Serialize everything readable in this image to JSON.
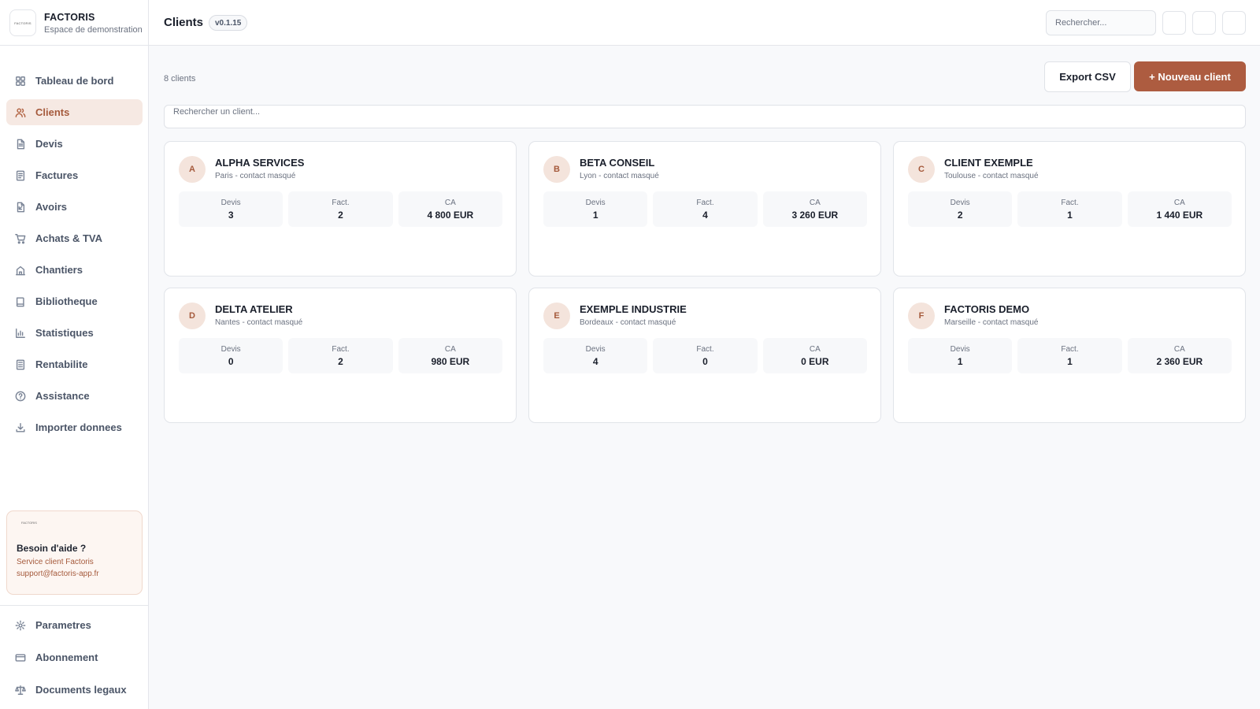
{
  "brand": {
    "name": "FACTORIS",
    "subtitle": "Espace de demonstration",
    "logo_text": "FACTORIS"
  },
  "nav": {
    "items": [
      {
        "label": "Tableau de bord",
        "icon": "dashboard-icon"
      },
      {
        "label": "Clients",
        "icon": "users-icon",
        "active": true
      },
      {
        "label": "Devis",
        "icon": "document-icon"
      },
      {
        "label": "Factures",
        "icon": "invoice-icon"
      },
      {
        "label": "Avoirs",
        "icon": "credit-note-icon"
      },
      {
        "label": "Achats & TVA",
        "icon": "cart-icon"
      },
      {
        "label": "Chantiers",
        "icon": "building-icon"
      },
      {
        "label": "Bibliotheque",
        "icon": "book-icon"
      },
      {
        "label": "Statistiques",
        "icon": "chart-icon"
      },
      {
        "label": "Rentabilite",
        "icon": "calculator-icon"
      },
      {
        "label": "Assistance",
        "icon": "help-circle-icon"
      },
      {
        "label": "Importer donnees",
        "icon": "download-icon"
      }
    ],
    "bottom_items": [
      {
        "label": "Parametres",
        "icon": "gear-icon"
      },
      {
        "label": "Abonnement",
        "icon": "credit-card-icon"
      },
      {
        "label": "Documents legaux",
        "icon": "scale-icon"
      }
    ]
  },
  "help": {
    "logo_text": "FACTORIS",
    "title": "Besoin d'aide ?",
    "line1": "Service client Factoris",
    "line2": "support@factoris-app.fr"
  },
  "topbar": {
    "title": "Clients",
    "version": "v0.1.15",
    "search_placeholder": "Rechercher..."
  },
  "main": {
    "count_label": "8 clients",
    "export_label": "Export CSV",
    "new_label": "+ Nouveau client",
    "search_placeholder": "Rechercher un client...",
    "stat_labels": {
      "devis": "Devis",
      "fact": "Fact.",
      "ca": "CA"
    },
    "clients": [
      {
        "initial": "A",
        "name": "ALPHA SERVICES",
        "sub": "Paris - contact masqué",
        "devis": "3",
        "fact": "2",
        "ca": "4 800 EUR"
      },
      {
        "initial": "B",
        "name": "BETA CONSEIL",
        "sub": "Lyon - contact masqué",
        "devis": "1",
        "fact": "4",
        "ca": "3 260 EUR"
      },
      {
        "initial": "C",
        "name": "CLIENT EXEMPLE",
        "sub": "Toulouse - contact masqué",
        "devis": "2",
        "fact": "1",
        "ca": "1 440 EUR"
      },
      {
        "initial": "D",
        "name": "DELTA ATELIER",
        "sub": "Nantes - contact masqué",
        "devis": "0",
        "fact": "2",
        "ca": "980 EUR"
      },
      {
        "initial": "E",
        "name": "EXEMPLE INDUSTRIE",
        "sub": "Bordeaux - contact masqué",
        "devis": "4",
        "fact": "0",
        "ca": "0 EUR"
      },
      {
        "initial": "F",
        "name": "FACTORIS DEMO",
        "sub": "Marseille - contact masqué",
        "devis": "1",
        "fact": "1",
        "ca": "2 360 EUR"
      }
    ]
  },
  "colors": {
    "accent": "#ad5c40",
    "active_bg": "#f6e9e3"
  }
}
